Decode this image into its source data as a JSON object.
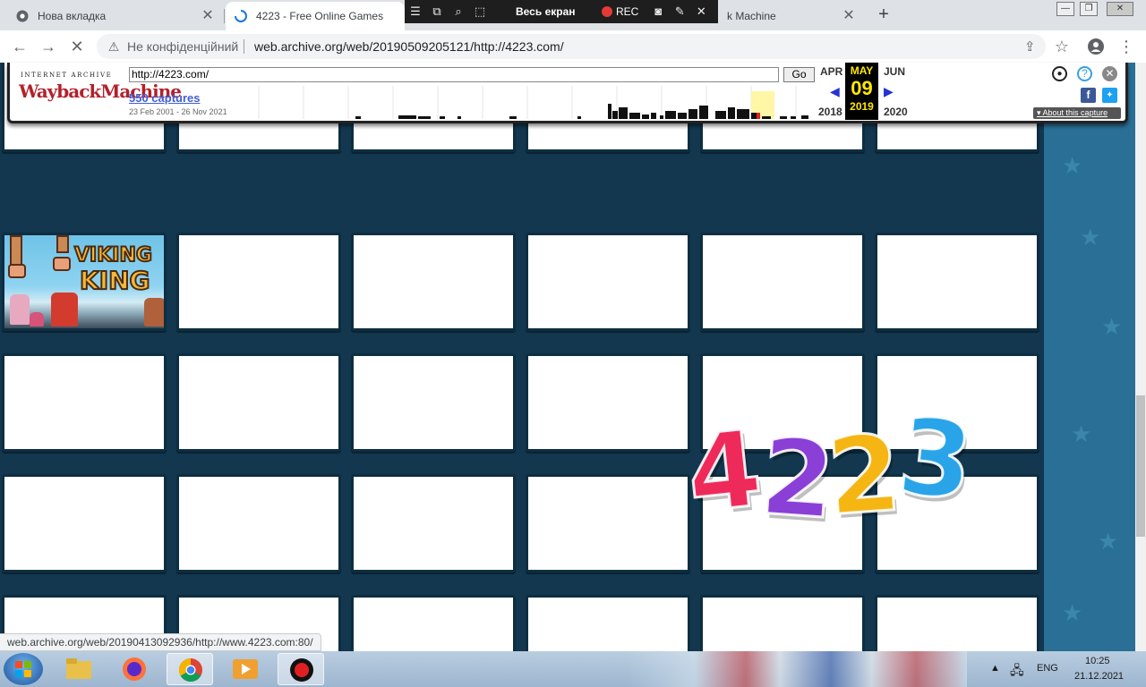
{
  "browser": {
    "tabs": [
      {
        "title": "Нова вкладка"
      },
      {
        "title": "4223 - Free Online Games"
      },
      {
        "title": "k Machine"
      }
    ],
    "omnibox": {
      "security_label": "Не конфіденційний",
      "url": "web.archive.org/web/20190509205121/http://4223.com/"
    },
    "status_url": "web.archive.org/web/20190413092936/http://www.4223.com:80/"
  },
  "recorder": {
    "fullscreen_label": "Весь екран",
    "rec_label": "REC"
  },
  "wayback": {
    "logo_top": "INTERNET ARCHIVE",
    "logo": "WaybackMachine",
    "url_value": "http://4223.com/",
    "go_label": "Go",
    "captures": "550 captures",
    "range": "23 Feb 2001 - 26 Nov 2021",
    "prev_month": "APR",
    "cur_month": "MAY",
    "next_month": "JUN",
    "day": "09",
    "prev_year": "2018",
    "cur_year": "2019",
    "next_year": "2020",
    "about": "About this capture"
  },
  "page": {
    "game_title_1": "VIKING",
    "game_title_2": "KING",
    "logo": [
      "4",
      "2",
      "2",
      "3"
    ],
    "logo_colors": [
      "#ee2a5a",
      "#8a3fd6",
      "#f5b614",
      "#2aa4e8"
    ]
  },
  "taskbar": {
    "lang": "ENG",
    "time": "10:25",
    "date": "21.12.2021"
  }
}
